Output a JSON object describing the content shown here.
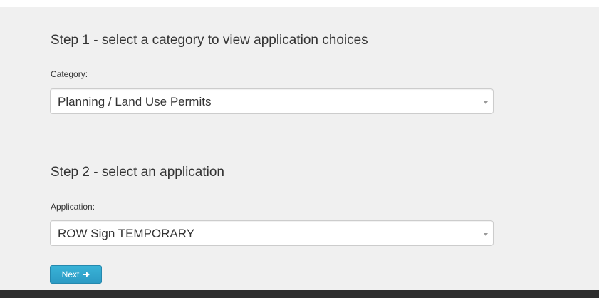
{
  "step1": {
    "heading": "Step 1 - select a category to view application choices",
    "label": "Category:",
    "selected_value": "Planning / Land Use Permits"
  },
  "step2": {
    "heading": "Step 2 - select an application",
    "label": "Application:",
    "selected_value": "ROW Sign TEMPORARY"
  },
  "actions": {
    "next_label": "Next",
    "next_icon": "arrow-right-icon"
  },
  "colors": {
    "panel_background": "#f0f0f0",
    "button_accent": "#39b3d7",
    "footer": "#2e2e2e"
  }
}
